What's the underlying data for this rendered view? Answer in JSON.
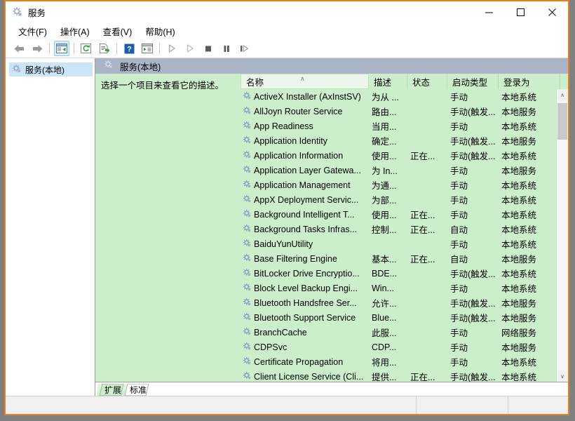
{
  "window": {
    "title": "服务",
    "title_icon": "services-gear-icon",
    "minimize_label": "—",
    "maximize_label": "☐",
    "close_label": "✕"
  },
  "menubar": {
    "items": [
      {
        "label": "文件(F)",
        "name": "menu-file"
      },
      {
        "label": "操作(A)",
        "name": "menu-action"
      },
      {
        "label": "查看(V)",
        "name": "menu-view"
      },
      {
        "label": "帮助(H)",
        "name": "menu-help"
      }
    ]
  },
  "toolbar": {
    "buttons": [
      {
        "name": "back-button",
        "icon": "arrow-left-icon"
      },
      {
        "name": "forward-button",
        "icon": "arrow-right-icon"
      },
      {
        "name": "show-hide-tree-button",
        "icon": "tree-pane-icon",
        "active": true
      },
      {
        "name": "refresh-button",
        "icon": "refresh-icon"
      },
      {
        "name": "export-list-button",
        "icon": "export-icon"
      },
      {
        "name": "help-button",
        "icon": "question-mark-icon"
      },
      {
        "name": "properties-button",
        "icon": "properties-icon"
      },
      {
        "name": "start-service-button",
        "icon": "play-icon"
      },
      {
        "name": "resume-service-button",
        "icon": "play-outline-icon"
      },
      {
        "name": "stop-service-button",
        "icon": "stop-icon"
      },
      {
        "name": "pause-service-button",
        "icon": "pause-icon"
      },
      {
        "name": "restart-service-button",
        "icon": "restart-icon"
      }
    ]
  },
  "tree": {
    "root": {
      "label": "服务(本地)",
      "icon": "services-gear-icon"
    }
  },
  "pane": {
    "header": "服务(本地)",
    "header_icon": "services-gear-icon",
    "description_placeholder": "选择一个项目来查看它的描述。"
  },
  "list": {
    "columns": [
      {
        "label": "名称",
        "name": "column-name",
        "sorted": "asc",
        "sort_glyph": "∧"
      },
      {
        "label": "描述",
        "name": "column-description"
      },
      {
        "label": "状态",
        "name": "column-status"
      },
      {
        "label": "启动类型",
        "name": "column-startup-type"
      },
      {
        "label": "登录为",
        "name": "column-log-on-as"
      }
    ],
    "rows": [
      {
        "name": "ActiveX Installer (AxInstSV)",
        "description": "为从 ...",
        "status": "",
        "startup": "手动",
        "logon": "本地系统"
      },
      {
        "name": "AllJoyn Router Service",
        "description": "路由...",
        "status": "",
        "startup": "手动(触发...",
        "logon": "本地服务"
      },
      {
        "name": "App Readiness",
        "description": "当用...",
        "status": "",
        "startup": "手动",
        "logon": "本地系统"
      },
      {
        "name": "Application Identity",
        "description": "确定...",
        "status": "",
        "startup": "手动(触发...",
        "logon": "本地服务"
      },
      {
        "name": "Application Information",
        "description": "使用...",
        "status": "正在...",
        "startup": "手动(触发...",
        "logon": "本地系统"
      },
      {
        "name": "Application Layer Gatewa...",
        "description": "为 In...",
        "status": "",
        "startup": "手动",
        "logon": "本地服务"
      },
      {
        "name": "Application Management",
        "description": "为通...",
        "status": "",
        "startup": "手动",
        "logon": "本地系统"
      },
      {
        "name": "AppX Deployment Servic...",
        "description": "为部...",
        "status": "",
        "startup": "手动",
        "logon": "本地系统"
      },
      {
        "name": "Background Intelligent T...",
        "description": "使用...",
        "status": "正在...",
        "startup": "手动",
        "logon": "本地系统"
      },
      {
        "name": "Background Tasks Infras...",
        "description": "控制...",
        "status": "正在...",
        "startup": "自动",
        "logon": "本地系统"
      },
      {
        "name": "BaiduYunUtility",
        "description": "",
        "status": "",
        "startup": "手动",
        "logon": "本地系统"
      },
      {
        "name": "Base Filtering Engine",
        "description": "基本...",
        "status": "正在...",
        "startup": "自动",
        "logon": "本地服务"
      },
      {
        "name": "BitLocker Drive Encryptio...",
        "description": "BDE...",
        "status": "",
        "startup": "手动(触发...",
        "logon": "本地系统"
      },
      {
        "name": "Block Level Backup Engi...",
        "description": "Win...",
        "status": "",
        "startup": "手动",
        "logon": "本地系统"
      },
      {
        "name": "Bluetooth Handsfree Ser...",
        "description": "允许...",
        "status": "",
        "startup": "手动(触发...",
        "logon": "本地服务"
      },
      {
        "name": "Bluetooth Support Service",
        "description": "Blue...",
        "status": "",
        "startup": "手动(触发...",
        "logon": "本地服务"
      },
      {
        "name": "BranchCache",
        "description": "此服...",
        "status": "",
        "startup": "手动",
        "logon": "网络服务"
      },
      {
        "name": "CDPSvc",
        "description": "CDP...",
        "status": "",
        "startup": "手动",
        "logon": "本地服务"
      },
      {
        "name": "Certificate Propagation",
        "description": "将用...",
        "status": "",
        "startup": "手动",
        "logon": "本地系统"
      },
      {
        "name": "Client License Service (Cli...",
        "description": "提供...",
        "status": "正在...",
        "startup": "手动(触发...",
        "logon": "本地系统"
      }
    ],
    "scrollbar": {
      "up_glyph": "∧",
      "down_glyph": "∨"
    }
  },
  "tabs": [
    {
      "label": "扩展",
      "name": "tab-extended",
      "active": true
    },
    {
      "label": "标准",
      "name": "tab-standard",
      "active": false
    }
  ],
  "statusbar": {
    "text": ""
  },
  "colors": {
    "window_border": "#e4801f",
    "list_background": "#cceecb",
    "pane_header": "#a9b4c6",
    "tree_selection": "#cce4f7",
    "desktop": "#808080"
  }
}
